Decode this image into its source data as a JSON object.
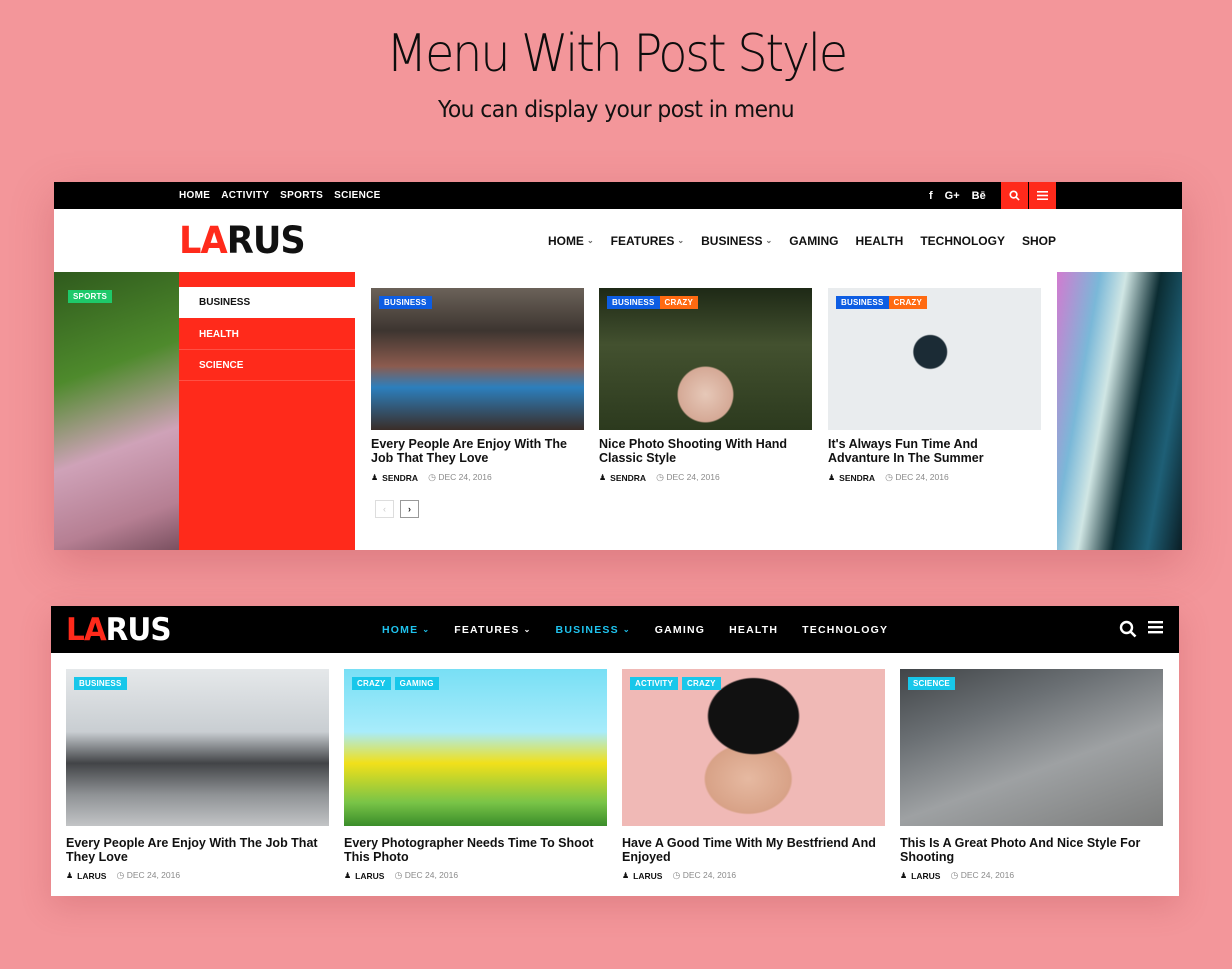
{
  "hero": {
    "title": "Menu With Post Style",
    "subtitle": "You can display your post in menu"
  },
  "demo1": {
    "topbar": {
      "nav": [
        "HOME",
        "ACTIVITY",
        "SPORTS",
        "SCIENCE"
      ],
      "social": {
        "facebook": "f",
        "google_plus": "G+",
        "behance": "Bē"
      },
      "search_icon": "search-icon",
      "menu_icon": "hamburger-icon"
    },
    "logo": {
      "accent": "LA",
      "rest": "RUS"
    },
    "mainnav": [
      {
        "label": "HOME",
        "dropdown": true
      },
      {
        "label": "FEATURES",
        "dropdown": true
      },
      {
        "label": "BUSINESS",
        "dropdown": true
      },
      {
        "label": "GAMING",
        "dropdown": false
      },
      {
        "label": "HEALTH",
        "dropdown": false
      },
      {
        "label": "TECHNOLOGY",
        "dropdown": false
      },
      {
        "label": "SHOP",
        "dropdown": false
      }
    ],
    "background_badge": "SPORTS",
    "mega_menu": {
      "categories": [
        {
          "label": "BUSINESS",
          "active": true
        },
        {
          "label": "HEALTH",
          "active": false
        },
        {
          "label": "SCIENCE",
          "active": false
        }
      ],
      "posts": [
        {
          "badges": [
            "BUSINESS"
          ],
          "title": "Every People Are Enjoy With The Job That They Love",
          "author": "SENDRA",
          "date": "DEC 24, 2016"
        },
        {
          "badges": [
            "BUSINESS",
            "CRAZY"
          ],
          "title": "Nice Photo Shooting With Hand Classic Style",
          "author": "SENDRA",
          "date": "DEC 24, 2016"
        },
        {
          "badges": [
            "BUSINESS",
            "CRAZY"
          ],
          "title": "It's Always Fun Time And Advanture In The Summer",
          "author": "SENDRA",
          "date": "DEC 24, 2016"
        }
      ],
      "pager": {
        "prev": "‹",
        "next": "›"
      }
    }
  },
  "demo2": {
    "logo": {
      "accent": "LA",
      "rest": "RUS"
    },
    "mainnav": [
      {
        "label": "HOME",
        "dropdown": true,
        "active": true
      },
      {
        "label": "FEATURES",
        "dropdown": true,
        "active": false
      },
      {
        "label": "BUSINESS",
        "dropdown": true,
        "active": true
      },
      {
        "label": "GAMING",
        "dropdown": false,
        "active": false
      },
      {
        "label": "HEALTH",
        "dropdown": false,
        "active": false
      },
      {
        "label": "TECHNOLOGY",
        "dropdown": false,
        "active": false
      }
    ],
    "posts": [
      {
        "badges": [
          "BUSINESS"
        ],
        "title": "Every People Are Enjoy With The Job That They Love",
        "author": "LARUS",
        "date": "DEC 24, 2016"
      },
      {
        "badges": [
          "CRAZY",
          "GAMING"
        ],
        "title": "Every Photographer Needs Time To Shoot This Photo",
        "author": "LARUS",
        "date": "DEC 24, 2016"
      },
      {
        "badges": [
          "ACTIVITY",
          "CRAZY"
        ],
        "title": "Have A Good Time With My Bestfriend And Enjoyed",
        "author": "LARUS",
        "date": "DEC 24, 2016"
      },
      {
        "badges": [
          "SCIENCE"
        ],
        "title": "This Is A Great Photo And Nice Style For Shooting",
        "author": "LARUS",
        "date": "DEC 24, 2016"
      }
    ]
  },
  "colors": {
    "page_bg": "#f3969a",
    "accent_red": "#ff2a1b",
    "badge_blue": "#0d5de3",
    "badge_orange": "#ff6a11",
    "badge_cyan": "#18c7ea",
    "nav_active_cyan": "#1fc3ee",
    "sports_green": "#1ec96a"
  }
}
